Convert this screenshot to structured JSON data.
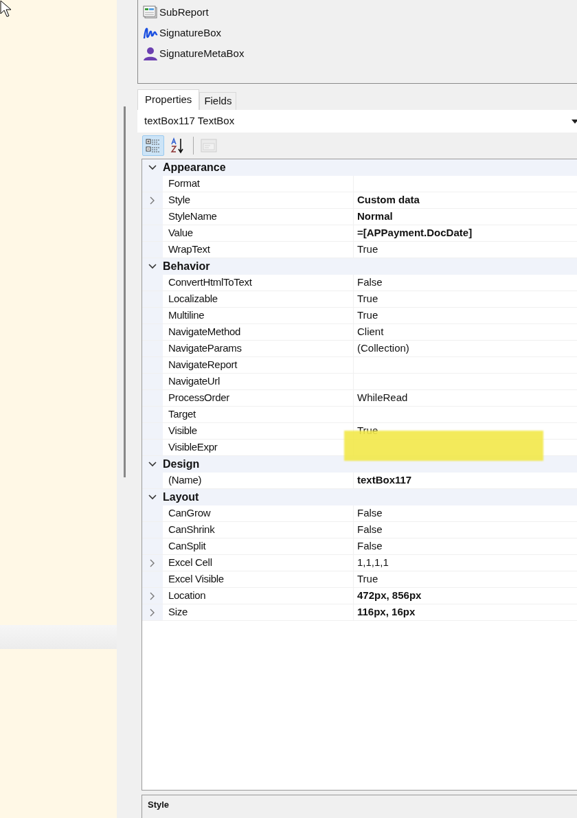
{
  "toolbox": {
    "items": [
      {
        "kind": "subreport",
        "label": "SubReport"
      },
      {
        "kind": "signature",
        "label": "SignatureBox"
      },
      {
        "kind": "person",
        "label": "SignatureMetaBox"
      }
    ]
  },
  "tabs": [
    {
      "label": "Properties",
      "selected": true
    },
    {
      "label": "Fields",
      "selected": false
    }
  ],
  "object_selector": {
    "value": "textBox117 TextBox"
  },
  "toolbar": [
    {
      "kind": "categorized",
      "selected": true,
      "disabled": false
    },
    {
      "kind": "alphabetical",
      "selected": false,
      "disabled": false
    },
    {
      "kind": "property-pages",
      "selected": false,
      "disabled": true
    }
  ],
  "property_grid": [
    {
      "category": "Appearance",
      "expanded": true,
      "properties": [
        {
          "name": "Format",
          "expandable": false
        },
        {
          "name": "Style",
          "value": "Custom data",
          "expandable": true,
          "bold": true
        },
        {
          "name": "StyleName",
          "value": "Normal",
          "expandable": false,
          "bold": true
        },
        {
          "name": "Value",
          "value": "=[APPayment.DocDate]",
          "expandable": false,
          "bold": true
        },
        {
          "name": "WrapText",
          "value": "True",
          "expandable": false,
          "bold": false
        }
      ]
    },
    {
      "category": "Behavior",
      "expanded": true,
      "properties": [
        {
          "name": "ConvertHtmlToText",
          "value": "False",
          "expandable": false,
          "bold": false
        },
        {
          "name": "Localizable",
          "value": "True",
          "expandable": false,
          "bold": false
        },
        {
          "name": "Multiline",
          "value": "True",
          "expandable": false,
          "bold": false
        },
        {
          "name": "NavigateMethod",
          "value": "Client",
          "expandable": false,
          "bold": false
        },
        {
          "name": "NavigateParams",
          "value": "(Collection)",
          "expandable": false,
          "bold": false
        },
        {
          "name": "NavigateReport",
          "expandable": false
        },
        {
          "name": "NavigateUrl",
          "expandable": false
        },
        {
          "name": "ProcessOrder",
          "value": "WhileRead",
          "expandable": false,
          "bold": false
        },
        {
          "name": "Target",
          "expandable": false
        },
        {
          "name": "Visible",
          "value": "True",
          "expandable": false,
          "bold": false
        },
        {
          "name": "VisibleExpr",
          "expandable": false,
          "redacted": true
        }
      ]
    },
    {
      "category": "Design",
      "expanded": true,
      "properties": [
        {
          "name": "(Name)",
          "value": "textBox117",
          "expandable": false,
          "bold": true
        }
      ]
    },
    {
      "category": "Layout",
      "expanded": true,
      "properties": [
        {
          "name": "CanGrow",
          "value": "False",
          "expandable": false,
          "bold": false
        },
        {
          "name": "CanShrink",
          "value": "False",
          "expandable": false,
          "bold": false
        },
        {
          "name": "CanSplit",
          "value": "False",
          "expandable": false,
          "bold": false
        },
        {
          "name": "Excel Cell",
          "value": "1,1,1,1",
          "expandable": true,
          "bold": false
        },
        {
          "name": "Excel Visible",
          "value": "True",
          "expandable": false,
          "bold": false
        },
        {
          "name": "Location",
          "value": "472px, 856px",
          "expandable": true,
          "bold": true
        },
        {
          "name": "Size",
          "value": "116px, 16px",
          "expandable": true,
          "bold": true
        }
      ]
    }
  ],
  "description": {
    "title": "Style"
  }
}
